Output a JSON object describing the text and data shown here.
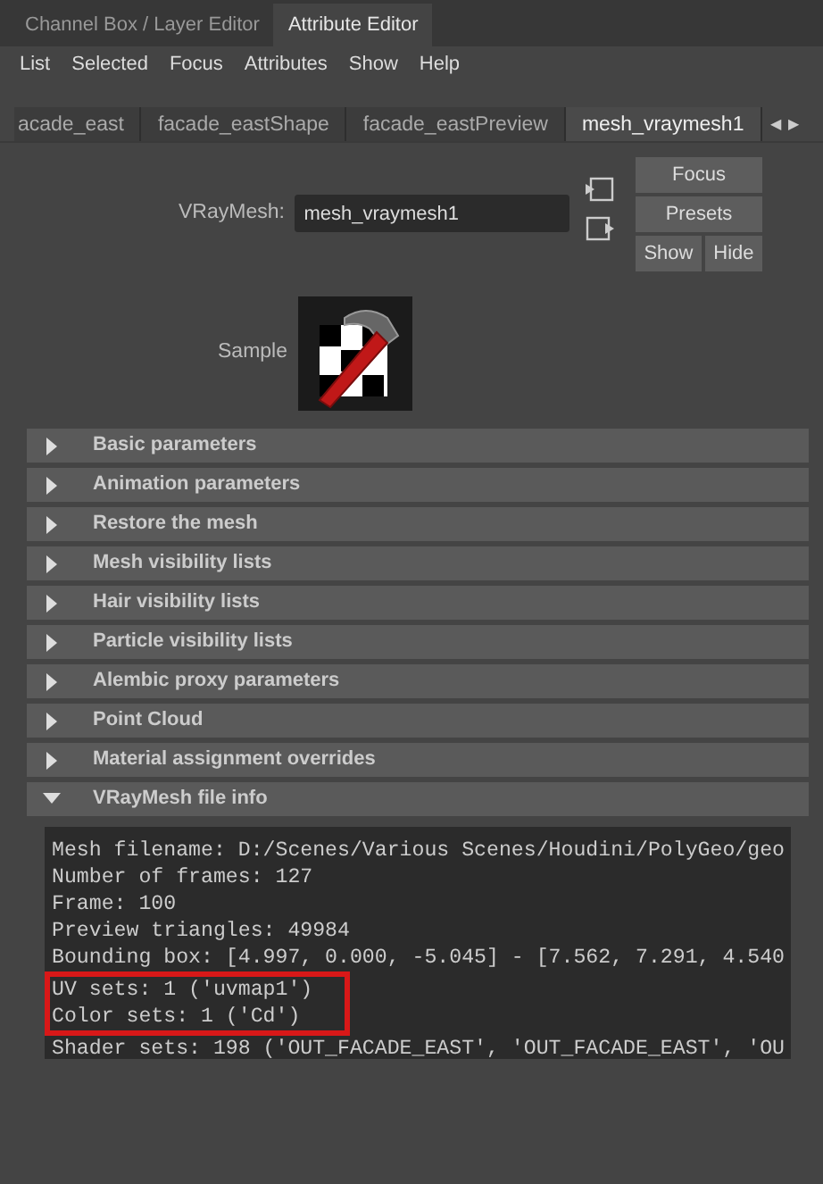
{
  "panel_tabs": [
    {
      "label": "Channel Box / Layer Editor",
      "selected": false
    },
    {
      "label": "Attribute Editor",
      "selected": true
    }
  ],
  "menu": [
    "List",
    "Selected",
    "Focus",
    "Attributes",
    "Show",
    "Help"
  ],
  "node_tabs": [
    {
      "label": "acade_east",
      "selected": false
    },
    {
      "label": "facade_eastShape",
      "selected": false
    },
    {
      "label": "facade_eastPreview",
      "selected": false
    },
    {
      "label": "mesh_vraymesh1",
      "selected": true
    }
  ],
  "tab_scroll": [
    "◀",
    "▶"
  ],
  "node": {
    "label": "VRayMesh:",
    "value": "mesh_vraymesh1"
  },
  "buttons": {
    "focus": "Focus",
    "presets": "Presets",
    "show": "Show",
    "hide": "Hide"
  },
  "sample": {
    "label": "Sample"
  },
  "sections": [
    {
      "label": "Basic parameters",
      "expanded": false
    },
    {
      "label": "Animation parameters",
      "expanded": false
    },
    {
      "label": "Restore the mesh",
      "expanded": false
    },
    {
      "label": "Mesh visibility lists",
      "expanded": false
    },
    {
      "label": "Hair visibility lists",
      "expanded": false
    },
    {
      "label": "Particle visibility lists",
      "expanded": false
    },
    {
      "label": "Alembic proxy parameters",
      "expanded": false
    },
    {
      "label": "Point Cloud",
      "expanded": false
    },
    {
      "label": "Material assignment overrides",
      "expanded": false
    },
    {
      "label": "VRayMesh file info",
      "expanded": true
    }
  ],
  "file_info": [
    {
      "text": "Mesh filename: D:/Scenes/Various Scenes/Houdini/PolyGeo/geo",
      "highlighted": false
    },
    {
      "text": "Number of frames: 127",
      "highlighted": false
    },
    {
      "text": "Frame: 100",
      "highlighted": false
    },
    {
      "text": "Preview triangles: 49984",
      "highlighted": false
    },
    {
      "text": "Bounding box: [4.997, 0.000, -5.045] - [7.562, 7.291, 4.540",
      "highlighted": false
    },
    {
      "text": "UV sets: 1 ('uvmap1')",
      "highlighted": true
    },
    {
      "text": "Color sets: 1 ('Cd')",
      "highlighted": true
    },
    {
      "text": "Shader sets: 198 ('OUT_FACADE_EAST', 'OUT_FACADE_EAST', 'OU",
      "highlighted": false
    }
  ]
}
